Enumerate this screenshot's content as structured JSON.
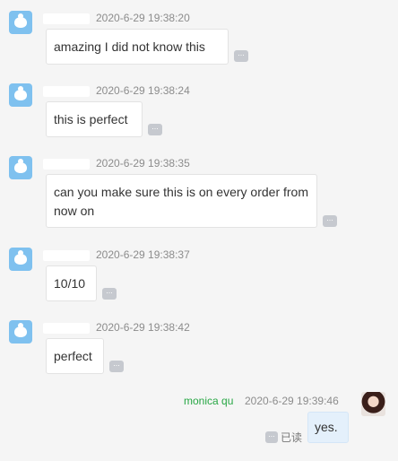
{
  "messages": [
    {
      "time": "2020-6-29 19:38:20",
      "text": "amazing I did not know this"
    },
    {
      "time": "2020-6-29 19:38:24",
      "text": "this is perfect"
    },
    {
      "time": "2020-6-29 19:38:35",
      "text": "can you make sure this is on every order from now on"
    },
    {
      "time": "2020-6-29 19:38:37",
      "text": "10/10"
    },
    {
      "time": "2020-6-29 19:38:42",
      "text": "perfect"
    }
  ],
  "self_message": {
    "sender": "monica qu",
    "time": "2020-6-29 19:39:46",
    "text": "yes.",
    "read_status": "已读"
  },
  "more_glyph": "...",
  "colors": {
    "background": "#f5f5f5",
    "avatar": "#7fc1ef",
    "self_name": "#28a745",
    "self_bubble": "#e4f0fb"
  }
}
